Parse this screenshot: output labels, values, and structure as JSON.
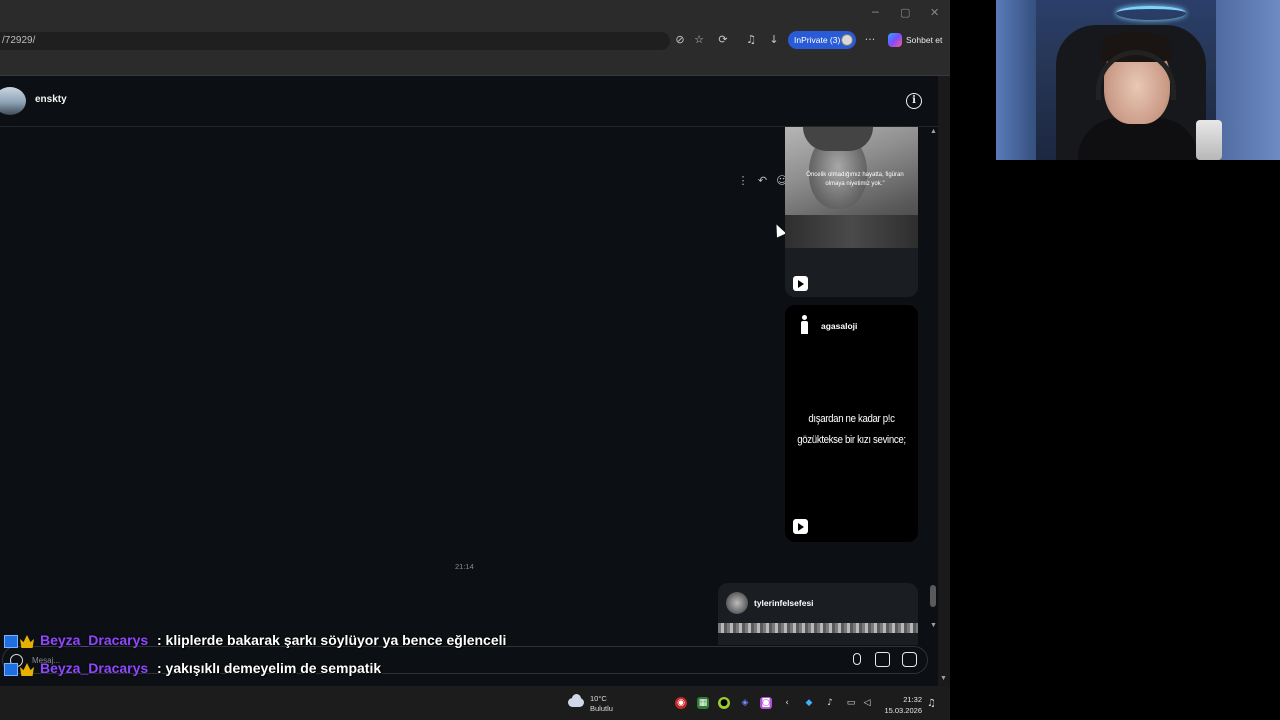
{
  "browser": {
    "url_fragment": "/72929/",
    "inprivate_label": "InPrivate (3)",
    "chat_label": "Sohbet et"
  },
  "dm": {
    "username": "enskty",
    "messages": [
      {
        "type": "reel",
        "quote": "Öncelik olmadığımız hayatta, figüran olmaya niyetimiz yok.\""
      },
      {
        "type": "reel",
        "author": "agasaloji",
        "text_line1": "dışardan ne kadar p!c",
        "text_line2": "gözüktekse bir kızı sevince;"
      },
      {
        "type": "timestamp",
        "time": "21:14"
      },
      {
        "type": "reel",
        "author": "tylerinfelsefesi"
      }
    ],
    "composer_placeholder": "Mesaj..."
  },
  "twitch_chat": [
    {
      "user": "Beyza_Dracarys",
      "message": ": kliplerde bakarak şarkı söylüyor ya bence eğlenceli"
    },
    {
      "user": "Beyza_Dracarys",
      "message": ": yakışıklı demeyelim de sempatik"
    }
  ],
  "taskbar": {
    "weather_temp": "10°C",
    "weather_desc": "Bulutlu",
    "time": "21:32",
    "date": "15.03.2026"
  },
  "colors": {
    "accent": "#2a5bd7",
    "twitch_name": "#9147ff",
    "chat_bg": "#0c1014"
  },
  "icons": {
    "info": "info-icon",
    "reply": "reply-icon",
    "react": "emoji-icon",
    "more": "more-icon",
    "play": "play-icon",
    "microphone": "microphone-icon",
    "image": "image-icon",
    "sticker": "sticker-icon"
  }
}
